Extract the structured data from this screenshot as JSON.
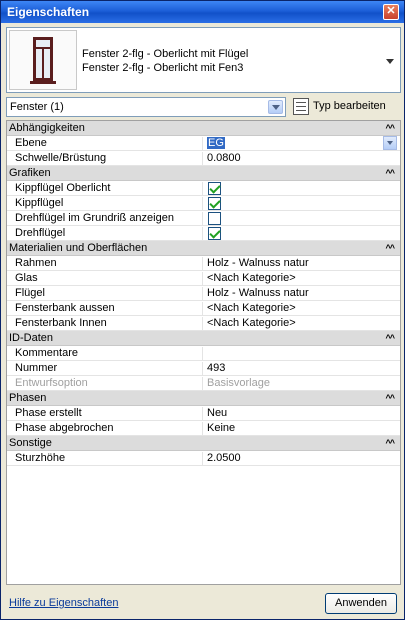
{
  "window": {
    "title": "Eigenschaften",
    "close_glyph": "✕"
  },
  "type_selector": {
    "family": "Fenster 2-flg - Oberlicht mit Flügel",
    "type": "Fenster 2-flg - Oberlicht mit Fen3",
    "thumbnail_icon": "window-thumbnail-icon"
  },
  "filter": {
    "value": "Fenster (1)"
  },
  "edit_type": {
    "label": "Typ bearbeiten"
  },
  "groups": {
    "abhaengigkeiten": {
      "label": "Abhängigkeiten",
      "rows": {
        "ebene": {
          "label": "Ebene",
          "value": "EG"
        },
        "schwelle": {
          "label": "Schwelle/Brüstung",
          "value": "0.0800"
        }
      }
    },
    "grafiken": {
      "label": "Grafiken",
      "rows": {
        "kipp_oberlicht": {
          "label": "Kippflügel Oberlicht",
          "checked": true
        },
        "kipp": {
          "label": "Kippflügel",
          "checked": true
        },
        "dreh_grundriss": {
          "label": "Drehflügel im Grundriß anzeigen",
          "checked": false
        },
        "dreh": {
          "label": "Drehflügel",
          "checked": true
        }
      }
    },
    "materialien": {
      "label": "Materialien und Oberflächen",
      "rows": {
        "rahmen": {
          "label": "Rahmen",
          "value": "Holz - Walnuss natur"
        },
        "glas": {
          "label": "Glas",
          "value": "<Nach Kategorie>"
        },
        "fluegel": {
          "label": "Flügel",
          "value": "Holz - Walnuss natur"
        },
        "fb_aussen": {
          "label": "Fensterbank aussen",
          "value": "<Nach Kategorie>"
        },
        "fb_innen": {
          "label": "Fensterbank Innen",
          "value": "<Nach Kategorie>"
        }
      }
    },
    "id_daten": {
      "label": "ID-Daten",
      "rows": {
        "kommentare": {
          "label": "Kommentare",
          "value": ""
        },
        "nummer": {
          "label": "Nummer",
          "value": "493"
        },
        "entwurfsoption": {
          "label": "Entwurfsoption",
          "value": "Basisvorlage"
        }
      }
    },
    "phasen": {
      "label": "Phasen",
      "rows": {
        "erstellt": {
          "label": "Phase erstellt",
          "value": "Neu"
        },
        "abgebrochen": {
          "label": "Phase abgebrochen",
          "value": "Keine"
        }
      }
    },
    "sonstige": {
      "label": "Sonstige",
      "rows": {
        "sturzhoehe": {
          "label": "Sturzhöhe",
          "value": "2.0500"
        }
      }
    }
  },
  "collapse_glyph": "^^",
  "footer": {
    "help_link": "Hilfe zu Eigenschaften",
    "apply_label": "Anwenden"
  },
  "colors": {
    "titlebar": "#1c5fd8",
    "selection": "#316ac5",
    "group_bg": "#dcdcdc",
    "check": "#21a121"
  }
}
